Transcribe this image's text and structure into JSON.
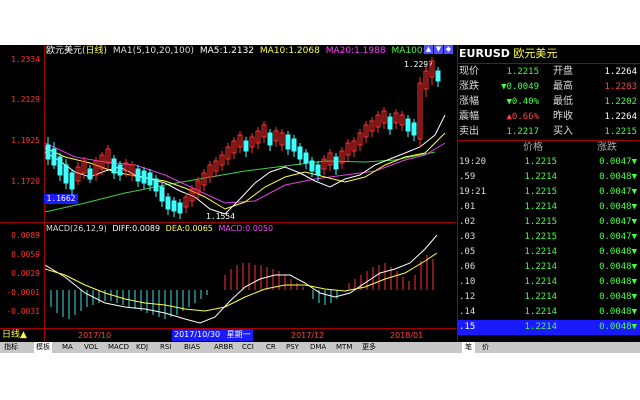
{
  "chart_header": {
    "symbol_name": "欧元美元",
    "period": "(日线)",
    "ma_label": "MA1(5,10,20,100)",
    "ma5": "MA5:1.2132",
    "ma10": "MA10:1.2068",
    "ma20": "MA20:1.1988",
    "ma100": "MA100:"
  },
  "price_axis": [
    "1.2334",
    "1.2129",
    "1.1925",
    "1.1720"
  ],
  "annotations": {
    "high": "1.2297",
    "low": "1.1554",
    "cursor_price": "1.1662"
  },
  "macd_header": {
    "label": "MACD(26,12,9)",
    "diff": "DIFF:0.0089",
    "dea": "DEA:0.0065",
    "macd": "MACD:0.0050"
  },
  "macd_axis": [
    "0.0089",
    "0.0059",
    "0.0029",
    "-0.0001",
    "-0.0031"
  ],
  "bottom_axis": {
    "period_label": "日线▲",
    "dates": [
      "2017/10",
      "2017/12",
      "2018/01"
    ],
    "cursor_date": "2017/10/30",
    "cursor_weekday": "星期一"
  },
  "quote_panel": {
    "symbol": "EURUSD",
    "name": "欧元美元",
    "rows": [
      {
        "l1": "现价",
        "v1": "1.2215",
        "c1": "#40ff40",
        "l2": "开盘",
        "v2": "1.2264",
        "c2": "#ffffff"
      },
      {
        "l1": "涨跌",
        "v1": "▼0.0049",
        "c1": "#40ff40",
        "l2": "最高",
        "v2": "1.2283",
        "c2": "#ff4040"
      },
      {
        "l1": "涨幅",
        "v1": "▼0.40%",
        "c1": "#40ff40",
        "l2": "最低",
        "v2": "1.2202",
        "c2": "#40ff40"
      },
      {
        "l1": "震幅",
        "v1": "▲0.66%",
        "c1": "#ff4040",
        "l2": "昨收",
        "v2": "1.2264",
        "c2": "#ffffff"
      },
      {
        "l1": "卖出",
        "v1": "1.2217",
        "c1": "#40ff40",
        "l2": "买入",
        "v2": "1.2215",
        "c2": "#40ff40"
      }
    ],
    "table_header": {
      "price": "价格",
      "change": "涨跌"
    },
    "ticks": [
      {
        "time": "19:20",
        "price": "1.2215",
        "change": "0.0047▼"
      },
      {
        "time": ".59",
        "price": "1.2214",
        "change": "0.0048▼"
      },
      {
        "time": "19:21",
        "price": "1.2215",
        "change": "0.0047▼"
      },
      {
        "time": ".01",
        "price": "1.2214",
        "change": "0.0048▼"
      },
      {
        "time": ".02",
        "price": "1.2215",
        "change": "0.0047▼"
      },
      {
        "time": ".03",
        "price": "1.2215",
        "change": "0.0047▼"
      },
      {
        "time": ".05",
        "price": "1.2214",
        "change": "0.0048▼"
      },
      {
        "time": ".06",
        "price": "1.2214",
        "change": "0.0048▼"
      },
      {
        "time": ".10",
        "price": "1.2214",
        "change": "0.0048▼"
      },
      {
        "time": ".12",
        "price": "1.2214",
        "change": "0.0048▼"
      },
      {
        "time": ".14",
        "price": "1.2214",
        "change": "0.0048▼"
      },
      {
        "time": ".15",
        "price": "1.2214",
        "change": "0.0048▼"
      }
    ],
    "bottom_tabs": [
      "笔",
      "价"
    ]
  },
  "indicator_tabs": [
    "指标",
    "模板",
    "MA",
    "VOL",
    "MACD",
    "KDJ",
    "RSI",
    "BIAS",
    "ARBR",
    "CCI",
    "CR",
    "PSY",
    "DMA",
    "MTM",
    "更多"
  ]
}
